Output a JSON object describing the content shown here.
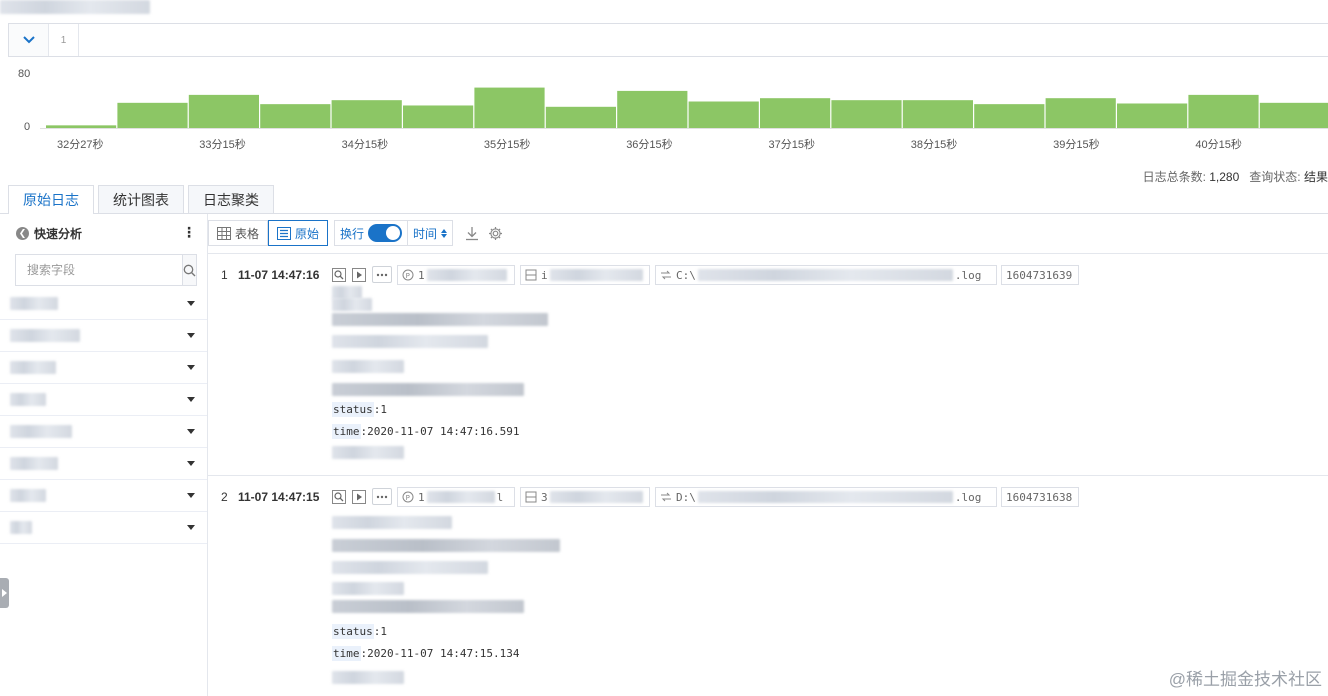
{
  "query": {
    "line_number": "1"
  },
  "histogram": {
    "y_ticks": [
      "80",
      "0"
    ],
    "x_ticks": [
      "32分27秒",
      "33分15秒",
      "34分15秒",
      "35分15秒",
      "36分15秒",
      "37分15秒",
      "38分15秒",
      "39分15秒",
      "40分15秒"
    ],
    "bar_color": "#8cc665",
    "y_max": 80,
    "values": [
      4,
      38,
      50,
      36,
      42,
      34,
      61,
      32,
      56,
      40,
      45,
      42,
      42,
      36,
      45,
      37,
      50,
      38
    ]
  },
  "summary": {
    "total_label": "日志总条数:",
    "total_value": "1,280",
    "status_label": "查询状态:",
    "status_value": "结果"
  },
  "tabs": [
    "原始日志",
    "统计图表",
    "日志聚类"
  ],
  "sidebar": {
    "title": "快速分析",
    "search_placeholder": "搜索字段",
    "field_count": 8
  },
  "toolbar": {
    "table_label": "表格",
    "raw_label": "原始",
    "wrap_label": "换行",
    "sort_label": "时间"
  },
  "logs": [
    {
      "index": "1",
      "time": "11-07 14:47:16",
      "source_prefix": "1",
      "host_prefix": "i",
      "path_prefix": "C:\\",
      "path_suffix": ".log",
      "tag_time": "1604731639",
      "status_key": "status",
      "status_value": ":1",
      "time_key": "time",
      "time_value": ":2020-11-07 14:47:16.591"
    },
    {
      "index": "2",
      "time": "11-07 14:47:15",
      "source_prefix": "1",
      "source_suffix": "l",
      "host_prefix": "3",
      "path_prefix": "D:\\",
      "path_suffix": ".log",
      "tag_time": "1604731638",
      "status_key": "status",
      "status_value": ":1",
      "time_key": "time",
      "time_value": ":2020-11-07 14:47:15.134"
    }
  ],
  "watermark": "@稀土掘金技术社区",
  "colors": {
    "accent": "#1a73c8",
    "bar": "#8cc665"
  },
  "icons": [
    "chevron-down-icon",
    "chevron-left-icon",
    "more-vertical-icon",
    "search-icon",
    "table-icon",
    "list-icon",
    "download-icon",
    "gear-icon",
    "context-search-icon",
    "play-icon",
    "ellipsis-icon",
    "source-icon",
    "host-icon",
    "file-icon"
  ]
}
